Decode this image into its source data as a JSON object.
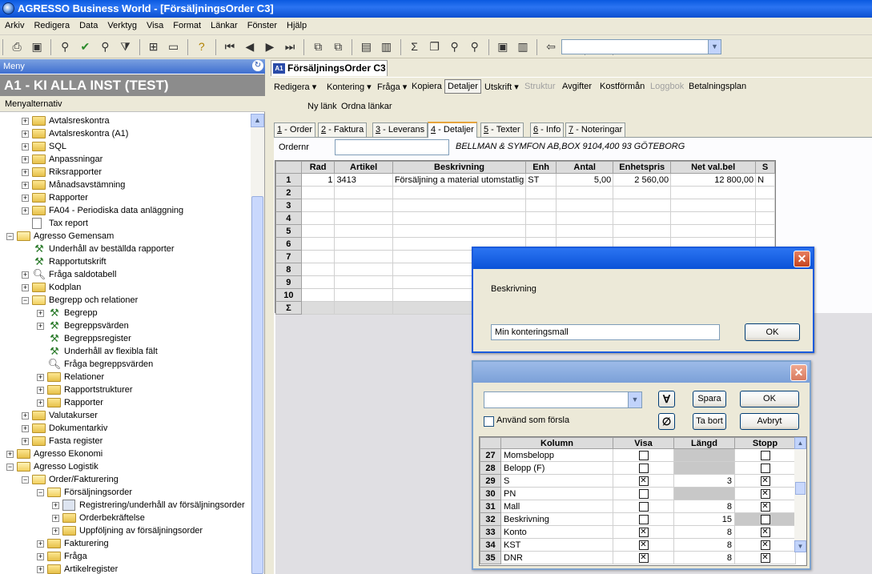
{
  "window": {
    "title": "AGRESSO Business World - [FörsäljningsOrder C3]"
  },
  "menubar": [
    "Arkiv",
    "Redigera",
    "Data",
    "Verktyg",
    "Visa",
    "Format",
    "Länkar",
    "Fönster",
    "Hjälp"
  ],
  "leftpane": {
    "header": "Meny",
    "company": "A1 - KI ALLA INST  (TEST)",
    "section": "Menyalternativ",
    "tree": [
      {
        "label": "Avtalsreskontra",
        "indent": 0,
        "exp": "+",
        "icon": "folder"
      },
      {
        "label": "Avtalsreskontra (A1)",
        "indent": 0,
        "exp": "+",
        "icon": "folder"
      },
      {
        "label": "SQL",
        "indent": 0,
        "exp": "+",
        "icon": "folder"
      },
      {
        "label": "Anpassningar",
        "indent": 0,
        "exp": "+",
        "icon": "folder"
      },
      {
        "label": "Riksrapporter",
        "indent": 0,
        "exp": "+",
        "icon": "folder"
      },
      {
        "label": "Månadsavstämning",
        "indent": 0,
        "exp": "+",
        "icon": "folder"
      },
      {
        "label": "Rapporter",
        "indent": 0,
        "exp": "+",
        "icon": "folder"
      },
      {
        "label": "FA04 - Periodiska data anläggning",
        "indent": 0,
        "exp": "+",
        "icon": "folder"
      },
      {
        "label": "Tax report",
        "indent": 0,
        "exp": "",
        "icon": "doc"
      },
      {
        "label": "Agresso Gemensam",
        "indent": -1,
        "exp": "-",
        "icon": "folder-open"
      },
      {
        "label": "Underhåll av beställda rapporter",
        "indent": 0,
        "exp": "",
        "icon": "tool"
      },
      {
        "label": "Rapportutskrift",
        "indent": 0,
        "exp": "",
        "icon": "tool"
      },
      {
        "label": "Fråga saldotabell",
        "indent": 0,
        "exp": "+",
        "icon": "search"
      },
      {
        "label": "Kodplan",
        "indent": 0,
        "exp": "+",
        "icon": "folder"
      },
      {
        "label": "Begrepp och relationer",
        "indent": 0,
        "exp": "-",
        "icon": "folder-open"
      },
      {
        "label": "Begrepp",
        "indent": 1,
        "exp": "+",
        "icon": "tool"
      },
      {
        "label": "Begreppsvärden",
        "indent": 1,
        "exp": "+",
        "icon": "tool"
      },
      {
        "label": "Begreppsregister",
        "indent": 1,
        "exp": "",
        "icon": "tool"
      },
      {
        "label": "Underhåll av flexibla fält",
        "indent": 1,
        "exp": "",
        "icon": "tool"
      },
      {
        "label": "Fråga begreppsvärden",
        "indent": 1,
        "exp": "",
        "icon": "search"
      },
      {
        "label": "Relationer",
        "indent": 1,
        "exp": "+",
        "icon": "folder"
      },
      {
        "label": "Rapportstrukturer",
        "indent": 1,
        "exp": "+",
        "icon": "folder"
      },
      {
        "label": "Rapporter",
        "indent": 1,
        "exp": "+",
        "icon": "folder"
      },
      {
        "label": "Valutakurser",
        "indent": 0,
        "exp": "+",
        "icon": "folder"
      },
      {
        "label": "Dokumentarkiv",
        "indent": 0,
        "exp": "+",
        "icon": "folder"
      },
      {
        "label": "Fasta register",
        "indent": 0,
        "exp": "+",
        "icon": "folder"
      },
      {
        "label": "Agresso Ekonomi",
        "indent": -1,
        "exp": "+",
        "icon": "folder"
      },
      {
        "label": "Agresso Logistik",
        "indent": -1,
        "exp": "-",
        "icon": "folder-open"
      },
      {
        "label": "Order/Fakturering",
        "indent": 0,
        "exp": "-",
        "icon": "folder-open"
      },
      {
        "label": "Försäljningsorder",
        "indent": 1,
        "exp": "-",
        "icon": "folder-open"
      },
      {
        "label": "Registrering/underhåll av försäljningsorder",
        "indent": 2,
        "exp": "+",
        "icon": "form"
      },
      {
        "label": "Orderbekräftelse",
        "indent": 2,
        "exp": "+",
        "icon": "folder"
      },
      {
        "label": "Uppföljning av försäljningsorder",
        "indent": 2,
        "exp": "+",
        "icon": "folder"
      },
      {
        "label": "Fakturering",
        "indent": 1,
        "exp": "+",
        "icon": "folder"
      },
      {
        "label": "Fråga",
        "indent": 1,
        "exp": "+",
        "icon": "folder"
      },
      {
        "label": "Artikelregister",
        "indent": 1,
        "exp": "+",
        "icon": "folder"
      }
    ]
  },
  "document": {
    "tab": "FörsäljningsOrder C3",
    "tab_badge": "A1",
    "toolbar": [
      {
        "label": "Redigera ▾",
        "enabled": true
      },
      {
        "label": "Kontering ▾",
        "enabled": true
      },
      {
        "label": "Fråga ▾",
        "enabled": true
      },
      {
        "label": "Kopiera",
        "enabled": true
      },
      {
        "label": "Detaljer",
        "enabled": true,
        "pressed": true
      },
      {
        "label": "Utskrift ▾",
        "enabled": true
      },
      {
        "label": "Struktur",
        "enabled": false
      },
      {
        "label": "Avgifter",
        "enabled": true
      },
      {
        "label": "Kostförmån",
        "enabled": true
      },
      {
        "label": "Loggbok",
        "enabled": false
      },
      {
        "label": "Betalningsplan",
        "enabled": true
      }
    ],
    "links": [
      "Ny länk",
      "Ordna länkar"
    ],
    "subtabs": [
      {
        "key": "1",
        "label": " - Order"
      },
      {
        "key": "2",
        "label": " - Faktura"
      },
      {
        "key": "3",
        "label": " - Leverans"
      },
      {
        "key": "4",
        "label": " - Detaljer",
        "active": true
      },
      {
        "key": "5",
        "label": " - Texter"
      },
      {
        "key": "6",
        "label": " - Info"
      },
      {
        "key": "7",
        "label": " - Noteringar"
      }
    ],
    "ordernr_label": "Ordernr",
    "ordernr_value": "",
    "customer": "BELLMAN & SYMFON AB,BOX 9104,400 93 GÖTEBORG",
    "grid": {
      "columns": [
        "Rad",
        "Artikel",
        "Beskrivning",
        "Enh",
        "Antal",
        "Enhetspris",
        "Net val.bel",
        "S"
      ],
      "rows": [
        [
          "1",
          "3413",
          "Försäljning a material utomstatlig",
          "ST",
          "5,00",
          "2 560,00",
          "12 800,00",
          "N"
        ],
        [
          "",
          "",
          "",
          "",
          "",
          "",
          "",
          ""
        ],
        [
          "",
          "",
          "",
          "",
          "",
          "",
          "",
          ""
        ],
        [
          "",
          "",
          "",
          "",
          "",
          "",
          "",
          ""
        ],
        [
          "",
          "",
          "",
          "",
          "",
          "",
          "",
          ""
        ],
        [
          "",
          "",
          "",
          "",
          "",
          "",
          "",
          ""
        ],
        [
          "",
          "",
          "",
          "",
          "",
          "",
          "",
          ""
        ],
        [
          "",
          "",
          "",
          "",
          "",
          "",
          "",
          ""
        ],
        [
          "",
          "",
          "",
          "",
          "",
          "",
          "",
          ""
        ],
        [
          "",
          "",
          "",
          "",
          "",
          "",
          "",
          ""
        ]
      ],
      "sum_label": "Σ"
    }
  },
  "dialog_desc": {
    "label": "Beskrivning",
    "value": "Min konteringsmall",
    "ok": "OK",
    "close": "✕"
  },
  "dialog_cols": {
    "combo_value": "",
    "btn_all": "∀",
    "btn_none": "∅",
    "spara": "Spara",
    "ok": "OK",
    "tabort": "Ta bort",
    "avbryt": "Avbryt",
    "checkbox_label": "Använd som försla",
    "close": "✕",
    "columns": [
      "Kolumn",
      "Visa",
      "Längd",
      "Stopp"
    ],
    "rows": [
      {
        "n": "27",
        "name": "Momsbelopp",
        "visa": false,
        "langd": "",
        "stopp": false,
        "gray": true
      },
      {
        "n": "28",
        "name": "Belopp (F)",
        "visa": false,
        "langd": "",
        "stopp": false,
        "gray": true
      },
      {
        "n": "29",
        "name": "S",
        "visa": true,
        "langd": "3",
        "stopp": true,
        "gray": false
      },
      {
        "n": "30",
        "name": "PN",
        "visa": false,
        "langd": "",
        "stopp": true,
        "gray": true
      },
      {
        "n": "31",
        "name": "Mall",
        "visa": false,
        "langd": "8",
        "stopp": true,
        "gray": false
      },
      {
        "n": "32",
        "name": "Beskrivning",
        "visa": false,
        "langd": "15",
        "stopp": false,
        "gray": false,
        "stoppgray": true
      },
      {
        "n": "33",
        "name": "Konto",
        "visa": true,
        "langd": "8",
        "stopp": true,
        "gray": false
      },
      {
        "n": "34",
        "name": "KST",
        "visa": true,
        "langd": "8",
        "stopp": true,
        "gray": false
      },
      {
        "n": "35",
        "name": "DNR",
        "visa": true,
        "langd": "8",
        "stopp": true,
        "gray": false
      }
    ]
  }
}
